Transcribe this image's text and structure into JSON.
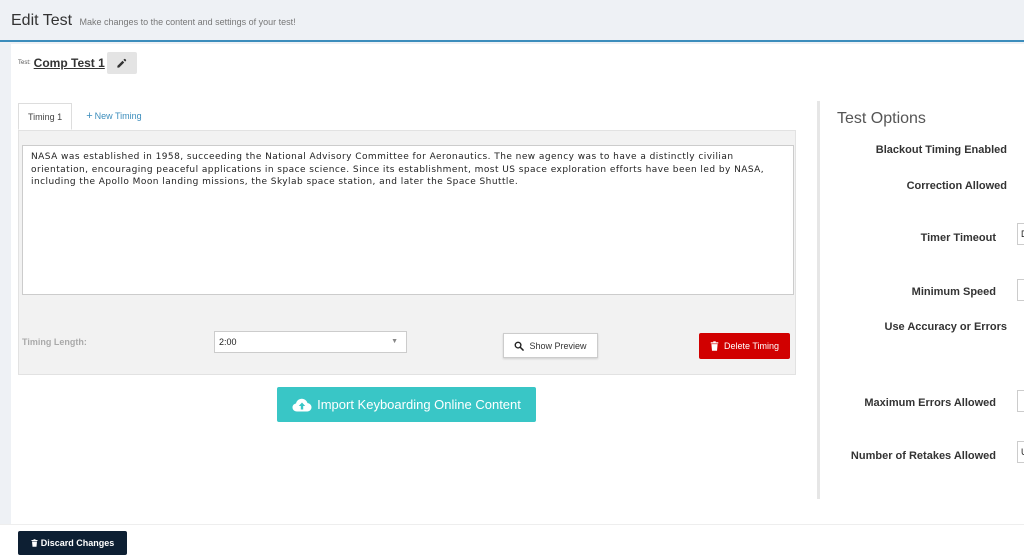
{
  "header": {
    "title": "Edit Test",
    "subtitle": "Make changes to the content and settings of your test!"
  },
  "test": {
    "label": "Test:",
    "name": "Comp Test 1",
    "edit_icon": "pencil-icon"
  },
  "tabs": [
    {
      "label": "Timing 1",
      "active": true
    },
    {
      "label": "New Timing",
      "active": false,
      "icon": "plus-icon"
    }
  ],
  "timing": {
    "passage": "NASA was established in 1958, succeeding the National Advisory Committee for Aeronautics. The new agency was to have a distinctly civilian orientation, encouraging peaceful applications in space science. Since its establishment, most US space exploration efforts have been led by NASA, including the Apollo Moon landing missions, the Skylab space station, and later the Space Shuttle.",
    "length_label": "Timing Length:",
    "length_value": "2:00",
    "preview_label": "Show Preview",
    "delete_label": "Delete Timing"
  },
  "import_label": "Import Keyboarding Online Content",
  "options": {
    "title": "Test Options",
    "items": [
      {
        "label": "Blackout Timing Enabled"
      },
      {
        "label": "Correction Allowed"
      },
      {
        "label": "Timer Timeout",
        "value": "D"
      },
      {
        "label": "Minimum Speed",
        "value": ""
      },
      {
        "label": "Use Accuracy or Errors"
      },
      {
        "label": "Maximum Errors Allowed",
        "value": ""
      },
      {
        "label": "Number of Retakes Allowed",
        "value": "U"
      }
    ]
  },
  "footer": {
    "discard_label": "Discard Changes"
  },
  "colors": {
    "accent": "#3c8dbc",
    "danger": "#d10000",
    "teal": "#39c6c6",
    "navy": "#0d1f33"
  }
}
